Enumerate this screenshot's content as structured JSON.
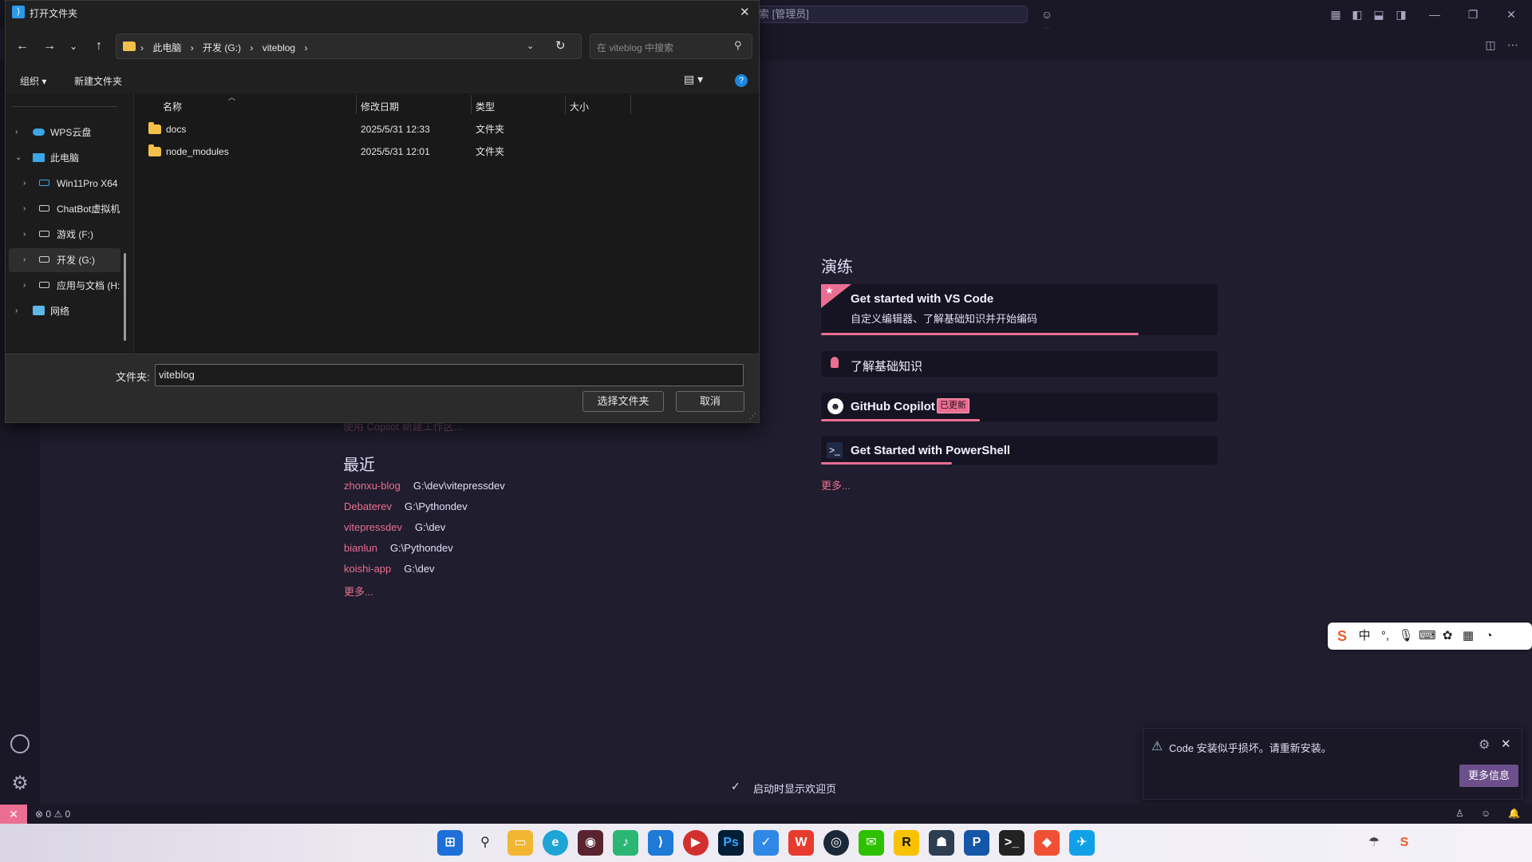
{
  "vscode": {
    "search_text": "索 [管理员]",
    "walkthroughs_title": "演练",
    "walkthroughs": [
      {
        "title": "Get started with VS Code",
        "desc": "自定义编辑器、了解基础知识并开始编码",
        "progress": 0.8
      },
      {
        "title": "了解基础知识"
      },
      {
        "title": "GitHub Copilot",
        "badge": "已更新",
        "progress": 0.4
      },
      {
        "title": "Get Started with PowerShell",
        "progress": 0.33
      }
    ],
    "walkthroughs_more": "更多...",
    "hidden_line": "使用 Copilot 新建工作区...",
    "recent_title": "最近",
    "recent": [
      {
        "name": "zhonxu-blog",
        "path": "G:\\dev\\vitepressdev"
      },
      {
        "name": "Debaterev",
        "path": "G:\\Pythondev"
      },
      {
        "name": "vitepressdev",
        "path": "G:\\dev"
      },
      {
        "name": "bianlun",
        "path": "G:\\Pythondev"
      },
      {
        "name": "koishi-app",
        "path": "G:\\dev"
      }
    ],
    "recent_more": "更多...",
    "show_on_startup": "启动时显示欢迎页",
    "status": {
      "errors": "0",
      "warnings": "0"
    }
  },
  "toast": {
    "message": "Code 安装似乎损坏。请重新安装。",
    "button": "更多信息"
  },
  "ime": {
    "mode": "中"
  },
  "dialog": {
    "title": "打开文件夹",
    "breadcrumb": [
      "此电脑",
      "开发 (G:)",
      "viteblog"
    ],
    "search_placeholder": "在 viteblog 中搜索",
    "organize": "组织",
    "new_folder": "新建文件夹",
    "tree": [
      {
        "label": "WPS云盘",
        "level": 0
      },
      {
        "label": "此电脑",
        "level": 0,
        "expanded": true
      },
      {
        "label": "Win11Pro X64",
        "level": 1
      },
      {
        "label": "ChatBot虚拟机",
        "level": 1
      },
      {
        "label": "游戏 (F:)",
        "level": 1
      },
      {
        "label": "开发 (G:)",
        "level": 1,
        "selected": true
      },
      {
        "label": "应用与文档 (H:)",
        "level": 1
      },
      {
        "label": "网络",
        "level": 0
      }
    ],
    "columns": [
      "名称",
      "修改日期",
      "类型",
      "大小"
    ],
    "files": [
      {
        "name": "docs",
        "date": "2025/5/31 12:33",
        "type": "文件夹"
      },
      {
        "name": "node_modules",
        "date": "2025/5/31 12:01",
        "type": "文件夹"
      }
    ],
    "folder_label": "文件夹:",
    "folder_value": "viteblog",
    "select_button": "选择文件夹",
    "cancel_button": "取消"
  },
  "colors": {
    "accent": "#eb6f92",
    "bg": "#1f1d2e",
    "panel": "#161422"
  }
}
